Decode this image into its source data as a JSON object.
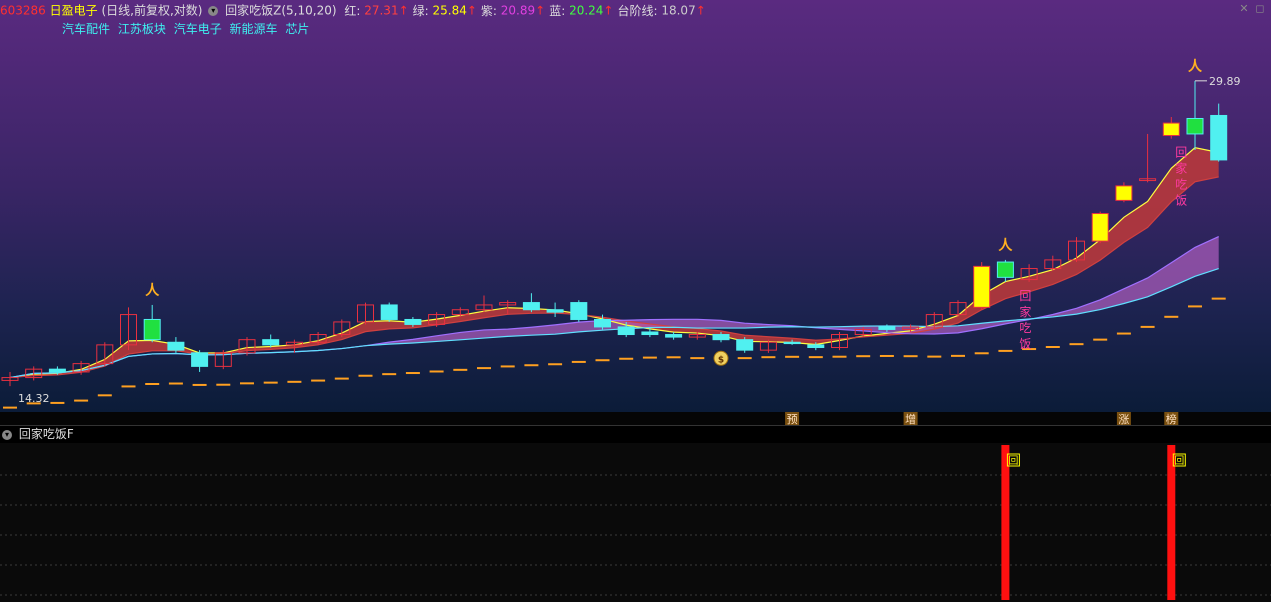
{
  "header": {
    "code": "603286",
    "name": "日盈电子",
    "mode": "(日线,前复权,对数)",
    "indicator": "回家吃饭Z(5,10,20)",
    "values": [
      {
        "label": "红: ",
        "value": "27.31",
        "color": "#ff4040"
      },
      {
        "label": "绿: ",
        "value": "25.84",
        "color": "#ffff00"
      },
      {
        "label": "紫: ",
        "value": "20.89",
        "color": "#e040e0"
      },
      {
        "label": "蓝: ",
        "value": "20.24",
        "color": "#40ff40"
      },
      {
        "label": "台阶线: ",
        "value": "18.07",
        "color": "#cccccc"
      }
    ],
    "up_arrow": "↑"
  },
  "tags": [
    "汽车配件",
    "江苏板块",
    "汽车电子",
    "新能源车",
    "芯片"
  ],
  "sub_panel": {
    "title": "回家吃饭F"
  },
  "colors": {
    "up": "#e83040",
    "down": "#50f0f0",
    "gold": "#ffff00",
    "green": "#20e040",
    "band": "#c03a3a",
    "purple_band": "#b060c0",
    "step": "#ffa020",
    "bar": "#ff1010"
  },
  "chart_data": {
    "type": "candlestick",
    "scale": "log",
    "ylim": [
      13.5,
      33
    ],
    "high_label": "29.89",
    "low_label": "14.32",
    "candles": [
      {
        "o": 14.5,
        "h": 14.8,
        "l": 14.3,
        "c": 14.6
      },
      {
        "o": 14.6,
        "h": 15.0,
        "l": 14.5,
        "c": 14.9
      },
      {
        "o": 14.9,
        "h": 15.0,
        "l": 14.7,
        "c": 14.8
      },
      {
        "o": 14.8,
        "h": 15.2,
        "l": 14.7,
        "c": 15.1
      },
      {
        "o": 15.1,
        "h": 15.9,
        "l": 15.0,
        "c": 15.8
      },
      {
        "o": 15.8,
        "h": 17.3,
        "l": 15.6,
        "c": 17.0
      },
      {
        "o": 16.8,
        "h": 17.4,
        "l": 15.9,
        "c": 16.0,
        "fill": "green"
      },
      {
        "o": 15.9,
        "h": 16.1,
        "l": 15.5,
        "c": 15.6
      },
      {
        "o": 15.5,
        "h": 15.6,
        "l": 14.8,
        "c": 15.0
      },
      {
        "o": 15.0,
        "h": 15.6,
        "l": 14.9,
        "c": 15.5
      },
      {
        "o": 15.5,
        "h": 16.1,
        "l": 15.4,
        "c": 16.0
      },
      {
        "o": 16.0,
        "h": 16.2,
        "l": 15.7,
        "c": 15.8
      },
      {
        "o": 15.8,
        "h": 16.0,
        "l": 15.5,
        "c": 15.9
      },
      {
        "o": 15.9,
        "h": 16.3,
        "l": 15.8,
        "c": 16.2
      },
      {
        "o": 16.2,
        "h": 16.8,
        "l": 16.1,
        "c": 16.7
      },
      {
        "o": 16.7,
        "h": 17.5,
        "l": 16.6,
        "c": 17.4
      },
      {
        "o": 17.4,
        "h": 17.5,
        "l": 16.7,
        "c": 16.8
      },
      {
        "o": 16.8,
        "h": 16.9,
        "l": 16.5,
        "c": 16.6
      },
      {
        "o": 16.6,
        "h": 17.1,
        "l": 16.5,
        "c": 17.0
      },
      {
        "o": 17.0,
        "h": 17.3,
        "l": 16.9,
        "c": 17.2
      },
      {
        "o": 17.2,
        "h": 17.8,
        "l": 17.1,
        "c": 17.4
      },
      {
        "o": 17.4,
        "h": 17.6,
        "l": 17.0,
        "c": 17.5
      },
      {
        "o": 17.5,
        "h": 17.9,
        "l": 17.1,
        "c": 17.2
      },
      {
        "o": 17.2,
        "h": 17.5,
        "l": 16.9,
        "c": 17.1
      },
      {
        "o": 17.5,
        "h": 17.6,
        "l": 16.7,
        "c": 16.8
      },
      {
        "o": 16.8,
        "h": 17.0,
        "l": 16.4,
        "c": 16.5
      },
      {
        "o": 16.5,
        "h": 16.7,
        "l": 16.1,
        "c": 16.2
      },
      {
        "o": 16.3,
        "h": 16.5,
        "l": 16.1,
        "c": 16.2
      },
      {
        "o": 16.2,
        "h": 16.3,
        "l": 16.0,
        "c": 16.1
      },
      {
        "o": 16.1,
        "h": 16.3,
        "l": 16.0,
        "c": 16.2
      },
      {
        "o": 16.2,
        "h": 16.3,
        "l": 15.9,
        "c": 16.0
      },
      {
        "o": 16.0,
        "h": 16.1,
        "l": 15.5,
        "c": 15.6
      },
      {
        "o": 15.6,
        "h": 16.0,
        "l": 15.5,
        "c": 15.9
      },
      {
        "o": 15.9,
        "h": 16.0,
        "l": 15.8,
        "c": 15.85
      },
      {
        "o": 15.8,
        "h": 15.9,
        "l": 15.6,
        "c": 15.7
      },
      {
        "o": 15.7,
        "h": 16.3,
        "l": 15.6,
        "c": 16.2
      },
      {
        "o": 16.2,
        "h": 16.5,
        "l": 16.1,
        "c": 16.4
      },
      {
        "o": 16.5,
        "h": 16.6,
        "l": 16.3,
        "c": 16.4
      },
      {
        "o": 16.4,
        "h": 16.6,
        "l": 16.3,
        "c": 16.5
      },
      {
        "o": 16.5,
        "h": 17.1,
        "l": 16.4,
        "c": 17.0
      },
      {
        "o": 17.0,
        "h": 17.6,
        "l": 16.9,
        "c": 17.5
      },
      {
        "o": 17.3,
        "h": 19.3,
        "l": 17.2,
        "c": 19.1,
        "fill": "gold"
      },
      {
        "o": 18.6,
        "h": 19.4,
        "l": 18.4,
        "c": 19.3,
        "fill": "green"
      },
      {
        "o": 18.5,
        "h": 19.2,
        "l": 18.4,
        "c": 19.0
      },
      {
        "o": 19.0,
        "h": 19.6,
        "l": 18.9,
        "c": 19.4
      },
      {
        "o": 19.4,
        "h": 20.5,
        "l": 19.3,
        "c": 20.3
      },
      {
        "o": 20.3,
        "h": 21.8,
        "l": 20.2,
        "c": 21.7,
        "fill": "gold"
      },
      {
        "o": 22.4,
        "h": 23.4,
        "l": 22.3,
        "c": 23.2,
        "fill": "gold"
      },
      {
        "o": 23.5,
        "h": 26.3,
        "l": 23.4,
        "c": 23.6
      },
      {
        "o": 26.2,
        "h": 27.4,
        "l": 26.0,
        "c": 27.0,
        "fill": "gold"
      },
      {
        "o": 26.3,
        "h": 29.9,
        "l": 25.3,
        "c": 27.3,
        "fill": "green"
      },
      {
        "o": 27.5,
        "h": 28.3,
        "l": 24.6,
        "c": 24.7
      }
    ],
    "signals": [
      {
        "candle": 6,
        "type": "person"
      },
      {
        "candle": 42,
        "type": "person"
      },
      {
        "candle": 50,
        "type": "person"
      },
      {
        "candle": 30,
        "type": "moneybag"
      }
    ],
    "vertical_labels": [
      {
        "candle": 42,
        "text": "回家吃饭"
      },
      {
        "candle": 49,
        "text": "回家吃饭"
      }
    ],
    "bottom_labels": [
      {
        "candle": 33,
        "text": "预"
      },
      {
        "candle": 38,
        "text": "增"
      },
      {
        "candle": 47,
        "text": "涨"
      },
      {
        "candle": 49,
        "text": "榜"
      }
    ],
    "sub_bars": [
      {
        "candle": 42,
        "label": "回"
      },
      {
        "candle": 49,
        "label": "回"
      }
    ]
  }
}
